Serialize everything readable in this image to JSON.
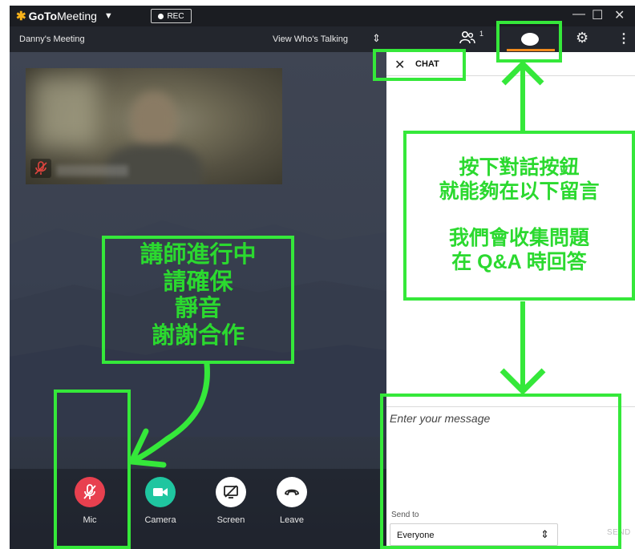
{
  "titlebar": {
    "brand_bold": "GoTo",
    "brand_rest": "Meeting",
    "rec_label": "REC",
    "minimize": "—",
    "maximize": "☐",
    "close": "✕"
  },
  "subbar": {
    "meeting_name": "Danny's Meeting",
    "view_mode": "View Who's Talking",
    "attendee_count": "1"
  },
  "controls": [
    {
      "label": "Mic",
      "color": "#e8404f",
      "icon": "mic-muted-icon"
    },
    {
      "label": "Camera",
      "color": "#1fc6a0",
      "icon": "camera-icon"
    },
    {
      "label": "Screen",
      "color": "#ffffff",
      "icon": "screen-share-off-icon"
    },
    {
      "label": "Leave",
      "color": "#ffffff",
      "icon": "phone-hangup-icon"
    }
  ],
  "chat": {
    "title": "CHAT",
    "message_placeholder": "Enter your message",
    "send_to_label": "Send to",
    "send_to_value": "Everyone",
    "send_button": "SEND"
  },
  "annotations": {
    "right_line1": "按下對話按鈕",
    "right_line2": "就能夠在以下留言",
    "right_line3": "我們會收集問題",
    "right_line4": "在 Q&A 時回答",
    "left_line1": "講師進行中",
    "left_line2": "請確保",
    "left_line3": "靜音",
    "left_line4": "謝謝合作",
    "color": "#35e83a"
  }
}
